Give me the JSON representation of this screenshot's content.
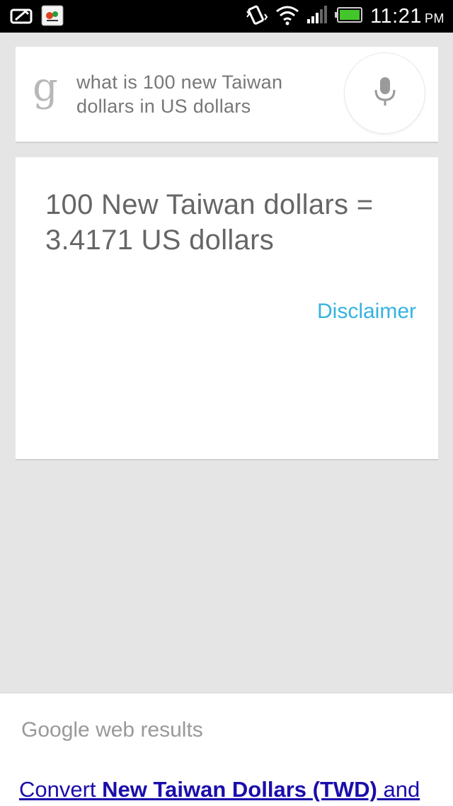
{
  "status_bar": {
    "time": "11:21",
    "ampm": "PM",
    "icons": [
      "notification-icon",
      "app-icon",
      "vibrate-icon",
      "wifi-icon",
      "signal-icon",
      "battery-icon"
    ]
  },
  "search": {
    "logo": "g",
    "query": "what is 100 new Taiwan dollars in US dollars",
    "mic_icon": "microphone-icon"
  },
  "result": {
    "text": "100 New Taiwan dollars = 3.4171 US dollars",
    "disclaimer": "Disclaimer"
  },
  "web_results": {
    "heading": "Google web results",
    "link_prefix": "Convert ",
    "link_bold_1": "New Taiwan Dollars",
    "link_mid": " ",
    "link_bold_2": "(TWD)",
    "link_suffix": " and"
  },
  "colors": {
    "accent": "#35b3e0",
    "link": "#1a0dab",
    "background": "#e5e5e5"
  }
}
